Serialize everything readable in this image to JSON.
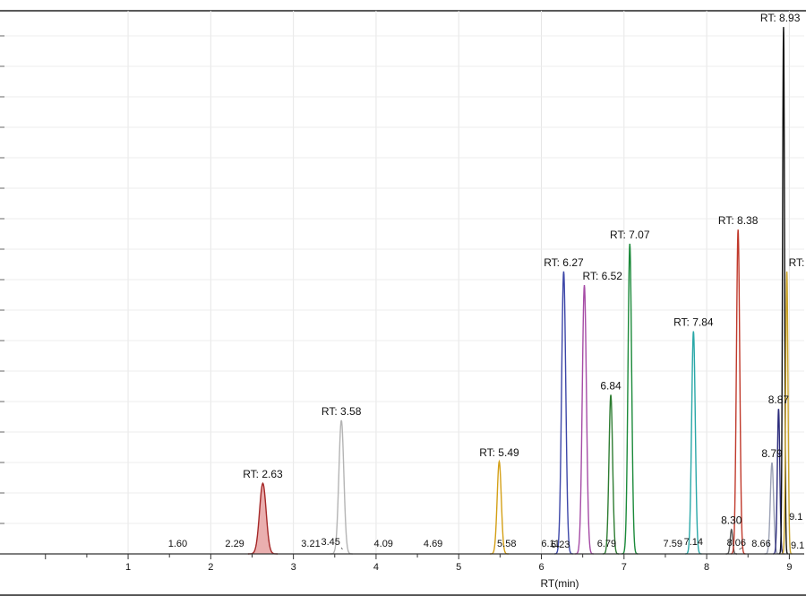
{
  "chart_data": {
    "type": "line",
    "title": "",
    "xlabel": "RT(min)",
    "ylabel": "",
    "xlim": [
      -0.55,
      9.18
    ],
    "ylim": [
      0,
      1.0
    ],
    "x_ticks": [
      1,
      2,
      3,
      4,
      5,
      6,
      7,
      8,
      9
    ],
    "x_tick_labels": [
      "1",
      "2",
      "3",
      "4",
      "5",
      "6",
      "7",
      "8",
      "9"
    ],
    "grid": true,
    "legend": "none",
    "series": [
      {
        "rt": 2.63,
        "height": 0.13,
        "width": 0.04,
        "color": "#a52828",
        "fill": "#e8a6a6",
        "label": "RT: 2.63"
      },
      {
        "rt": 3.58,
        "height": 0.246,
        "width": 0.03,
        "color": "#b4b4b4",
        "label": "RT: 3.58"
      },
      {
        "rt": 5.49,
        "height": 0.17,
        "width": 0.025,
        "color": "#d4a017",
        "label": "RT: 5.49"
      },
      {
        "rt": 6.27,
        "height": 0.52,
        "width": 0.025,
        "color": "#3c46a8",
        "label": "RT: 6.27"
      },
      {
        "rt": 6.52,
        "height": 0.495,
        "width": 0.025,
        "color": "#a64ca6",
        "label": "RT: 6.52"
      },
      {
        "rt": 6.84,
        "height": 0.293,
        "width": 0.022,
        "color": "#2e7d32",
        "label": "6.84"
      },
      {
        "rt": 7.07,
        "height": 0.571,
        "width": 0.022,
        "color": "#1b8a3a",
        "label": "RT: 7.07"
      },
      {
        "rt": 7.84,
        "height": 0.41,
        "width": 0.022,
        "color": "#2aa8a8",
        "label": "RT: 7.84"
      },
      {
        "rt": 8.3,
        "height": 0.045,
        "width": 0.015,
        "color": "#555555",
        "label": "8.30"
      },
      {
        "rt": 8.38,
        "height": 0.597,
        "width": 0.02,
        "color": "#c0392b",
        "label": "RT: 8.38"
      },
      {
        "rt": 8.79,
        "height": 0.168,
        "width": 0.02,
        "color": "#9aa0b4",
        "label": "8.79"
      },
      {
        "rt": 8.87,
        "height": 0.267,
        "width": 0.015,
        "color": "#2c2c7c",
        "label": "8.87"
      },
      {
        "rt": 8.93,
        "height": 0.97,
        "width": 0.012,
        "color": "#111111",
        "label": "RT: 8.93"
      },
      {
        "rt": 8.97,
        "height": 0.52,
        "width": 0.014,
        "color": "#c9a227",
        "label": "RT:"
      }
    ],
    "minor_labels": [
      "1.60",
      "2.29",
      "3.21",
      "3.45",
      "4.09",
      "4.69",
      "5.58",
      "6.11",
      "6.23",
      "6.79",
      "7.59",
      "7.14",
      "8.06",
      "8.66",
      "9.1",
      "9.1"
    ]
  }
}
